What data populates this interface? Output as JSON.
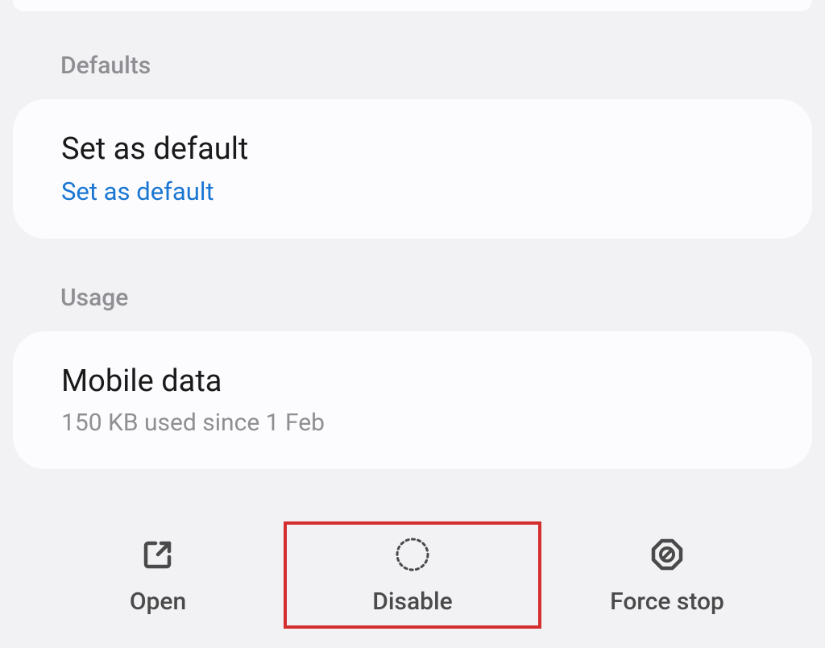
{
  "sections": {
    "defaults": {
      "header": "Defaults",
      "item": {
        "title": "Set as default",
        "link": "Set as default"
      }
    },
    "usage": {
      "header": "Usage",
      "item": {
        "title": "Mobile data",
        "subtitle": "150 KB used since 1 Feb"
      }
    }
  },
  "actions": {
    "open": {
      "label": "Open"
    },
    "disable": {
      "label": "Disable"
    },
    "force_stop": {
      "label": "Force stop"
    }
  }
}
